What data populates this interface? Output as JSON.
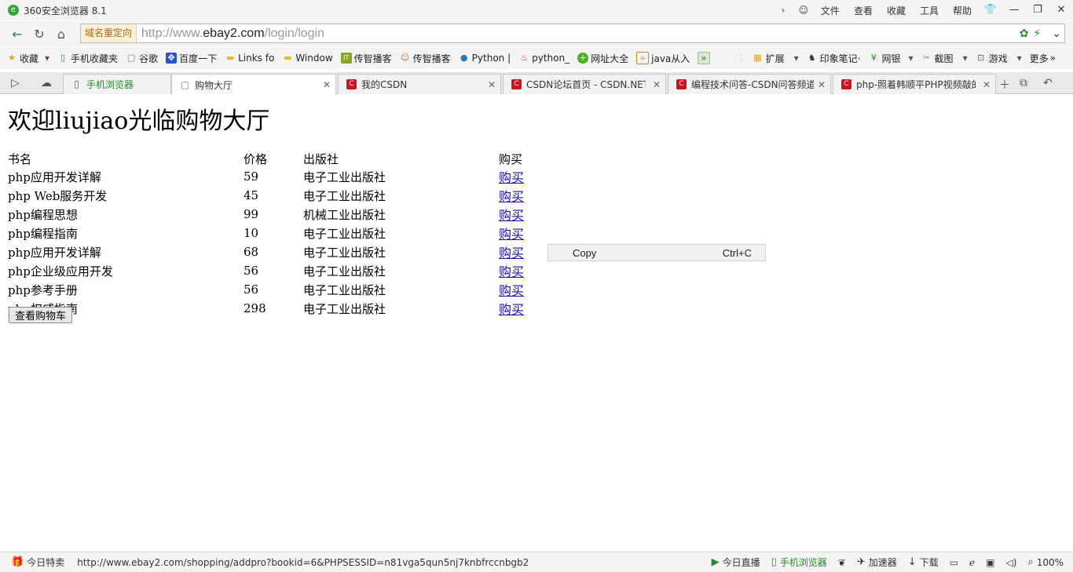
{
  "window": {
    "title": "360安全浏览器 8.1",
    "menus": [
      "文件",
      "查看",
      "收藏",
      "工具",
      "帮助"
    ]
  },
  "address": {
    "redirect_label": "域名重定向",
    "url_prefix": "http://www.",
    "url_domain": "ebay2.com",
    "url_path": "/login/login"
  },
  "bookmarks": [
    {
      "label": "收藏",
      "icon": "star-icon"
    },
    {
      "label": "手机收藏夹",
      "icon": "phone-icon"
    },
    {
      "label": "谷歌",
      "icon": "page-icon"
    },
    {
      "label": "百度一下",
      "icon": "baidu-icon"
    },
    {
      "label": "Links fo",
      "icon": "folder-icon"
    },
    {
      "label": "Window",
      "icon": "folder-icon"
    },
    {
      "label": "传智播客",
      "icon": "itcast-icon"
    },
    {
      "label": "传智播客",
      "icon": "itcast-icon"
    },
    {
      "label": "Python |",
      "icon": "globe-icon"
    },
    {
      "label": "python_",
      "icon": "flame-icon"
    },
    {
      "label": "网址大全",
      "icon": "plus-circle-icon"
    },
    {
      "label": "java从入",
      "icon": "java-icon"
    }
  ],
  "toolbar_right": [
    {
      "label": "扩展"
    },
    {
      "label": "印象笔记·"
    },
    {
      "label": "网银"
    },
    {
      "label": "截图"
    },
    {
      "label": "游戏"
    },
    {
      "label": "更多"
    }
  ],
  "tabs": [
    {
      "label": "手机浏览器",
      "icon": "phone-icon",
      "active": false
    },
    {
      "label": "购物大厅",
      "icon": "page-icon",
      "active": true
    },
    {
      "label": "我的CSDN",
      "icon": "csdn-icon",
      "active": false
    },
    {
      "label": "CSDN论坛首页 - CSDN.NET",
      "icon": "csdn-icon",
      "active": false
    },
    {
      "label": "编程技术问答-CSDN问答频道",
      "icon": "csdn-icon",
      "active": false
    },
    {
      "label": "php-照着韩顺平PHP视频敲的",
      "icon": "csdn-icon",
      "active": false
    }
  ],
  "page": {
    "welcome": "欢迎liujiao光临购物大厅",
    "headers": [
      "书名",
      "价格",
      "出版社",
      "购买"
    ],
    "books": [
      {
        "name": "php应用开发详解",
        "price": "59",
        "publisher": "电子工业出版社",
        "buy": "购买"
      },
      {
        "name": "php Web服务开发",
        "price": "45",
        "publisher": "电子工业出版社",
        "buy": "购买"
      },
      {
        "name": "php编程思想",
        "price": "99",
        "publisher": "机械工业出版社",
        "buy": "购买"
      },
      {
        "name": "php编程指南",
        "price": "10",
        "publisher": "电子工业出版社",
        "buy": "购买"
      },
      {
        "name": "php应用开发详解",
        "price": "68",
        "publisher": "电子工业出版社",
        "buy": "购买"
      },
      {
        "name": "php企业级应用开发",
        "price": "56",
        "publisher": "电子工业出版社",
        "buy": "购买"
      },
      {
        "name": "php参考手册",
        "price": "56",
        "publisher": "电子工业出版社",
        "buy": "购买"
      },
      {
        "name": "php权威指南",
        "price": "298",
        "publisher": "电子工业出版社",
        "buy": "购买"
      }
    ],
    "cart_button": "查看购物车"
  },
  "context_menu": {
    "label": "Copy",
    "shortcut": "Ctrl+C"
  },
  "status": {
    "left_label": "今日特卖",
    "link_url": "http://www.ebay2.com/shopping/addpro?bookid=6&PHPSESSID=n81vga5qun5nj7knbfrccnbgb2",
    "items": [
      "今日直播",
      "手机浏览器",
      "加速器",
      "下载"
    ],
    "zoom": "100%"
  },
  "colors": {
    "accent_green": "#2a8a2a",
    "link_blue": "#1a0dab",
    "csdn_red": "#c9161d"
  }
}
